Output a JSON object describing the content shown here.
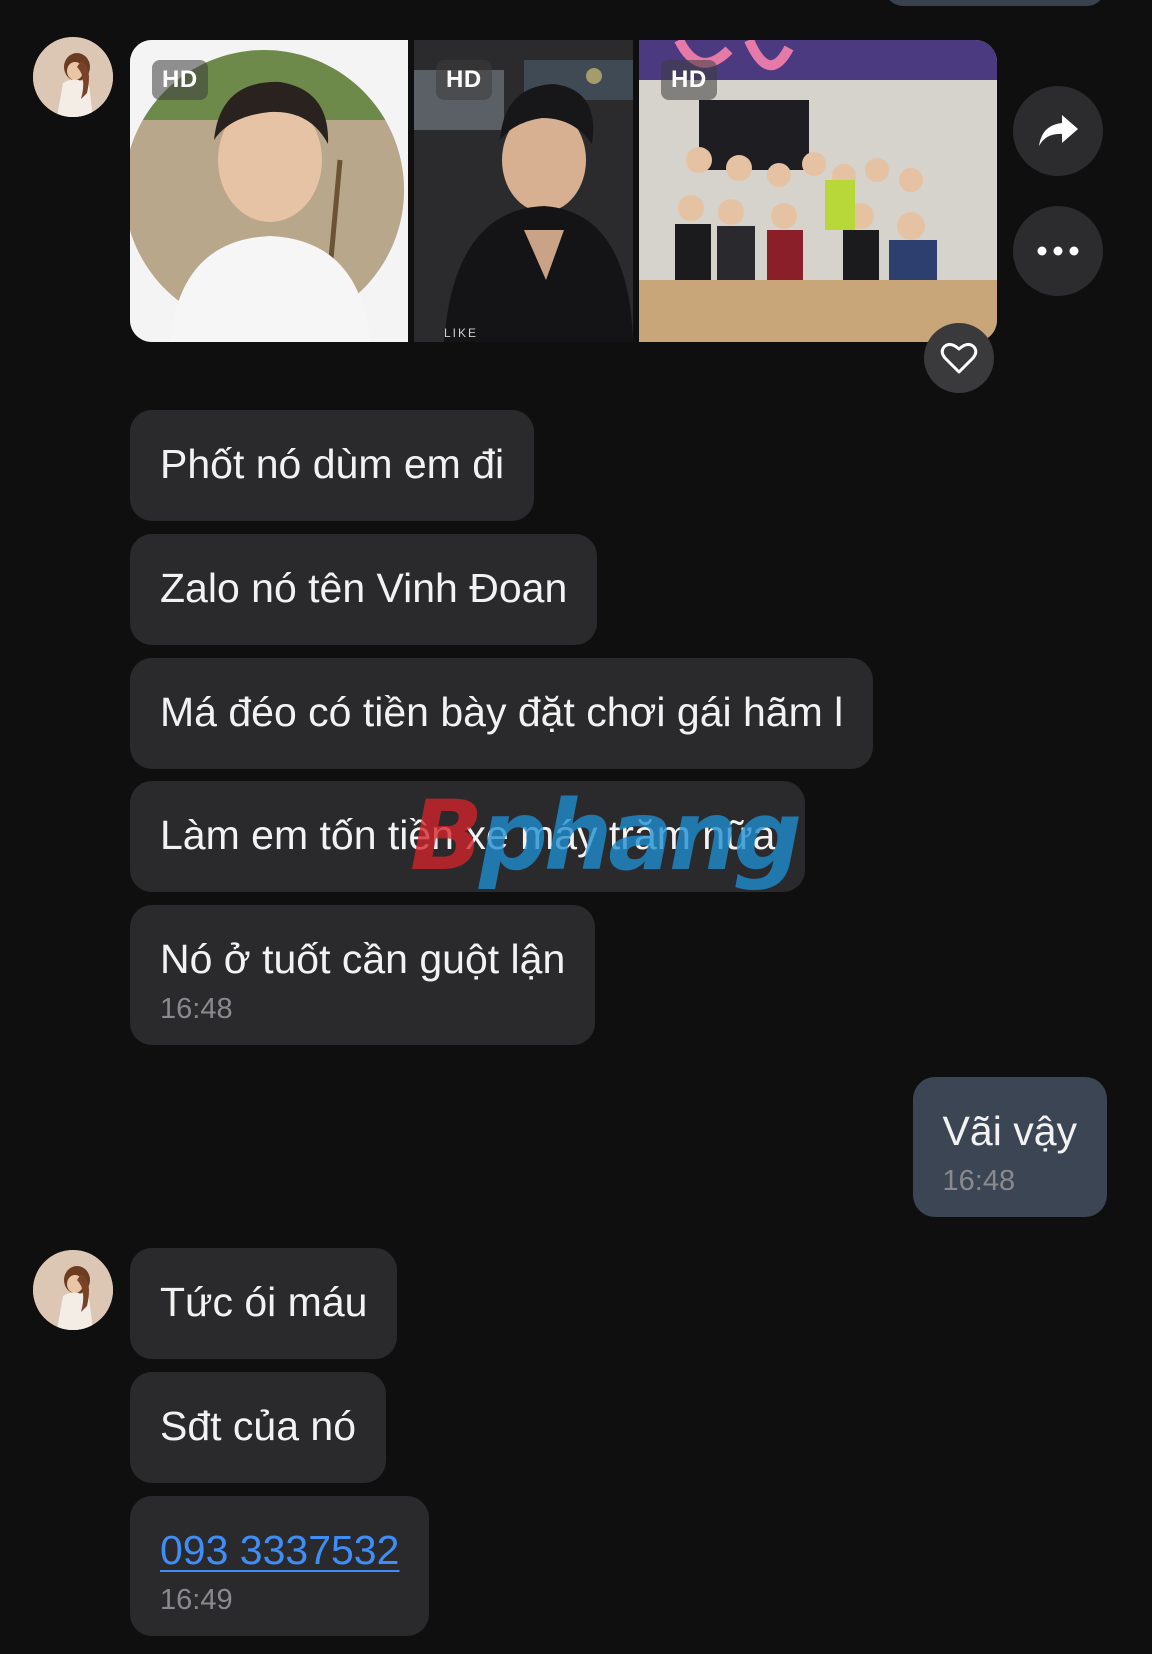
{
  "chat": {
    "photos": [
      {
        "badge": "HD",
        "kind": "portrait-outdoor"
      },
      {
        "badge": "HD",
        "kind": "selfie-night"
      },
      {
        "badge": "HD",
        "kind": "group-restaurant"
      }
    ],
    "photo_caption_partial": "LIKE",
    "actions": {
      "share_icon": "share-forward-icon",
      "more_icon": "more-horizontal-icon",
      "like_icon": "heart-outline-icon"
    },
    "group1": [
      {
        "text": "Phốt nó dùm em đi"
      },
      {
        "text": "Zalo nó tên Vinh Đoan"
      },
      {
        "text": "Má đéo có tiền bày đặt chơi gái hãm l"
      },
      {
        "text": "Làm em tốn tiền xe máy trăm nữa"
      },
      {
        "text": "Nó ở tuốt cần guột lận",
        "time": "16:48"
      }
    ],
    "outgoing": {
      "text": "Vãi vậy",
      "time": "16:48"
    },
    "group2": [
      {
        "text": "Tức ói máu"
      },
      {
        "text": "Sđt của nó"
      },
      {
        "text": "093 3337532",
        "time": "16:49",
        "is_link": true
      }
    ],
    "watermark": {
      "part_red": "B",
      "part_blue": "phang"
    },
    "colors": {
      "background": "#0f0f0f",
      "incoming_bubble": "#2a2a2c",
      "outgoing_bubble": "#3b4553",
      "link": "#3f8ef7",
      "timestamp": "#8a8a8e"
    }
  }
}
